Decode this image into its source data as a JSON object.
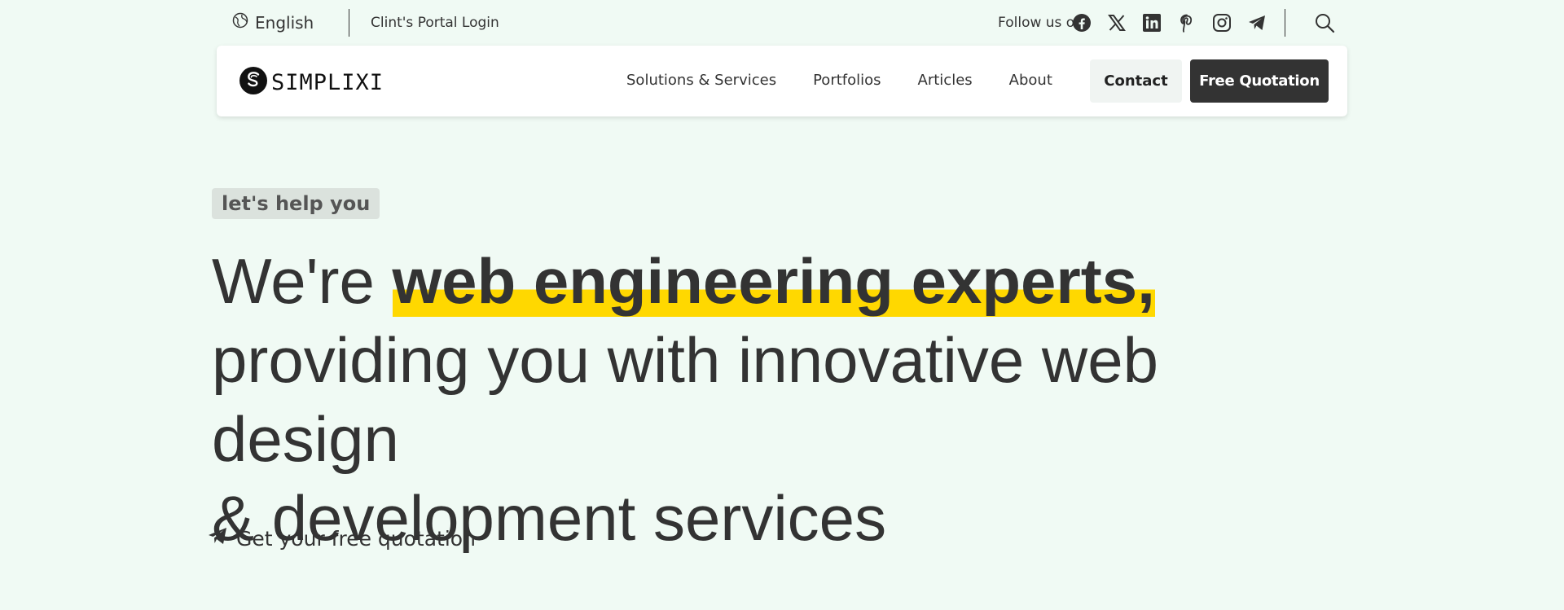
{
  "topbar": {
    "language": "English",
    "portal_link": "Clint's Portal Login",
    "follow_label": "Follow us on",
    "socials": [
      "facebook-icon",
      "x-icon",
      "linkedin-icon",
      "pinterest-icon",
      "instagram-icon",
      "telegram-icon"
    ]
  },
  "nav": {
    "logo_text": "SIMPLIXI",
    "menu": [
      "Solutions & Services",
      "Portfolios",
      "Articles",
      "About"
    ],
    "contact_label": "Contact",
    "quote_label": "Free Quotation"
  },
  "hero": {
    "tag": "let's help you",
    "headline_prefix": "We're ",
    "headline_strong": "web engineering experts,",
    "headline_line2": "providing you with innovative web design",
    "headline_line3": "& development services",
    "cta_label": "Get your free quotation"
  },
  "colors": {
    "background": "#f0faf4",
    "highlight": "#ffd800",
    "dark_button": "#333333",
    "text": "#333333"
  }
}
